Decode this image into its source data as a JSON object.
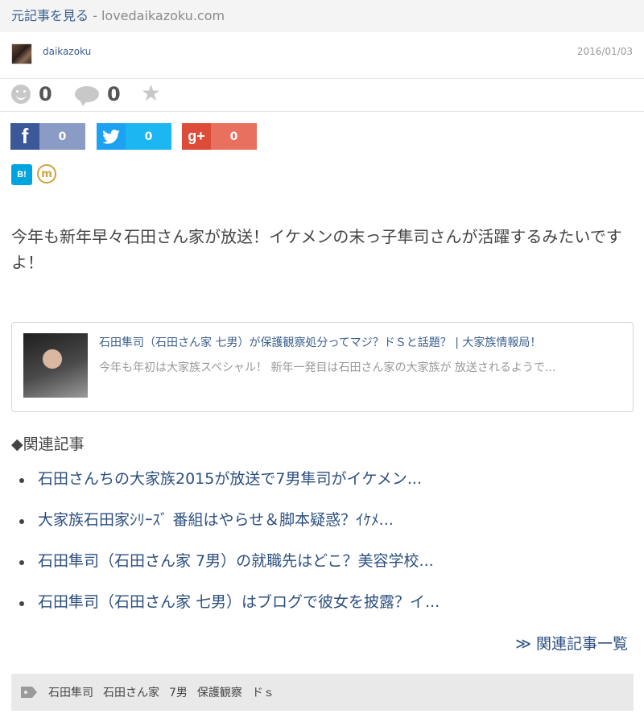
{
  "source": {
    "link_text": "元記事を見る",
    "separator": " - ",
    "domain": "lovedaikazoku.com"
  },
  "author": {
    "name": "daikazoku",
    "date": "2016/01/03"
  },
  "stats": {
    "likes": "0",
    "comments": "0"
  },
  "share": {
    "facebook": {
      "icon": "f",
      "count": "0",
      "color": "#3b5998"
    },
    "twitter": {
      "icon": "twitter-bird-icon",
      "count": "0",
      "color": "#1da1f2"
    },
    "googleplus": {
      "icon": "g+",
      "count": "0",
      "color": "#dd4b39"
    },
    "hatena": {
      "icon": "B!"
    },
    "mixi": {
      "icon": "m"
    }
  },
  "article": {
    "lead": "今年も新年早々石田さん家が放送！イケメンの末っ子隼司さんが活躍するみたいですよ！"
  },
  "card": {
    "title": "石田隼司（石田さん家 七男）が保護観察処分ってマジ？ドＳと話題？ | 大家族情報局！",
    "desc": "今年も年初は大家族スペシャル！ 新年一発目は石田さん家の大家族が 放送されるようで..."
  },
  "related": {
    "heading": "◆関連記事",
    "items": [
      "石田さんちの大家族2015が放送で7男隼司がイケメン...",
      "大家族石田家ｼﾘｰｽﾞ 番組はやらせ＆脚本疑惑？ｲｹﾒ...",
      "石田隼司（石田さん家 7男）の就職先はどこ？美容学校...",
      "石田隼司（石田さん家 七男）はブログで彼女を披露？イ..."
    ],
    "more": "≫ 関連記事一覧"
  },
  "tags": [
    "石田隼司",
    "石田さん家",
    "7男",
    "保護観察",
    "ドｓ"
  ]
}
